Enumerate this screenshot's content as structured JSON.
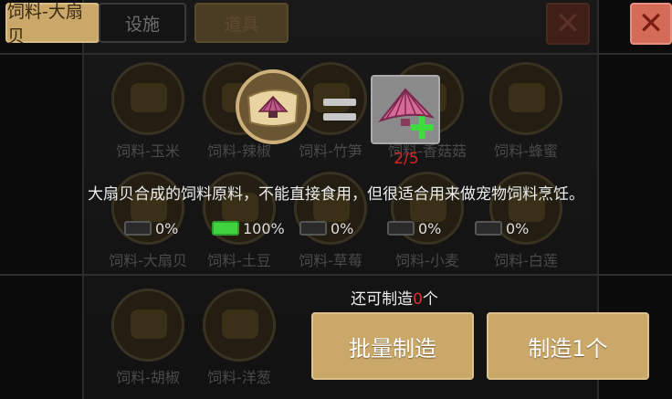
{
  "tabs": {
    "active_label": "饲料-大扇贝",
    "facility_label": "设施",
    "ghost_label": "道具"
  },
  "background_items": [
    {
      "label": "饲料-玉米"
    },
    {
      "label": "饲料-辣椒"
    },
    {
      "label": "饲料-竹笋"
    },
    {
      "label": "饲料-香菇菇"
    },
    {
      "label": "饲料-蜂蜜"
    },
    {
      "label": "饲料-大扇贝"
    },
    {
      "label": "饲料-土豆"
    },
    {
      "label": "饲料-草莓"
    },
    {
      "label": "饲料-小麦"
    },
    {
      "label": "饲料-白莲"
    },
    {
      "label": "饲料-胡椒"
    },
    {
      "label": "饲料-洋葱"
    }
  ],
  "recipe": {
    "result_count": "2/5",
    "description": "大扇贝合成的饲料原料，不能直接食用，但很适合用来做宠物饲料烹饪。"
  },
  "ingredients": [
    {
      "percent": "0%",
      "full": false
    },
    {
      "percent": "100%",
      "full": true
    },
    {
      "percent": "0%",
      "full": false
    },
    {
      "percent": "0%",
      "full": false
    },
    {
      "percent": "0%",
      "full": false
    }
  ],
  "craft": {
    "can_make_prefix": "还可制造",
    "can_make_num": "0",
    "can_make_suffix": "个",
    "batch_label": "批量制造",
    "one_label": "制造1个"
  },
  "colors": {
    "accent_gold": "#c9a86a",
    "close_red": "#d46a58",
    "progress_green": "#3fd43f",
    "count_red": "#dd2222"
  }
}
